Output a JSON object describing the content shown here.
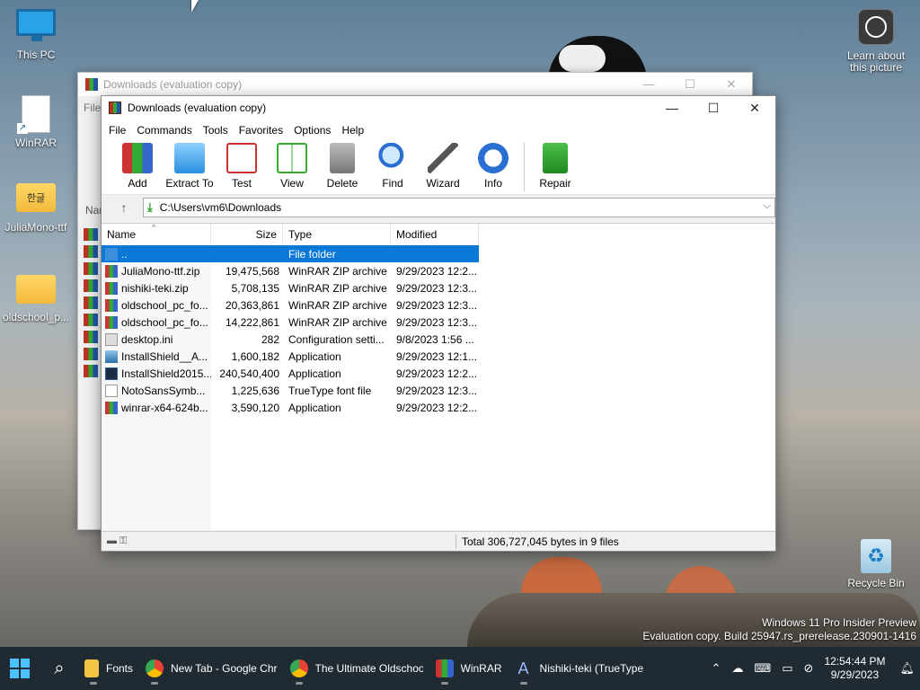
{
  "desktop": {
    "icons": [
      {
        "label": "This PC"
      },
      {
        "label": "WinRAR"
      },
      {
        "label": "JuliaMono-ttf"
      },
      {
        "label": "oldschool_p..."
      }
    ],
    "folder_glyph": "한글",
    "learn_label": "Learn about this picture",
    "recycle_label": "Recycle Bin",
    "watermark_line1": "Windows 11 Pro Insider Preview",
    "watermark_line2": "Evaluation copy. Build 25947.rs_prerelease.230901-1416"
  },
  "back_window": {
    "title": "Downloads (evaluation copy)",
    "menu_peek": "File",
    "col_peek": "Nar"
  },
  "window": {
    "title": "Downloads (evaluation copy)",
    "menu": [
      "File",
      "Commands",
      "Tools",
      "Favorites",
      "Options",
      "Help"
    ],
    "toolbar": [
      {
        "label": "Add",
        "icon": "add-archive-icon"
      },
      {
        "label": "Extract To",
        "icon": "extract-folder-icon"
      },
      {
        "label": "Test",
        "icon": "test-checklist-icon"
      },
      {
        "label": "View",
        "icon": "view-book-icon"
      },
      {
        "label": "Delete",
        "icon": "trash-can-icon"
      },
      {
        "label": "Find",
        "icon": "magnifier-icon"
      },
      {
        "label": "Wizard",
        "icon": "magic-wand-icon"
      },
      {
        "label": "Info",
        "icon": "info-icon"
      },
      {
        "label": "Repair",
        "icon": "repair-kit-icon"
      }
    ],
    "address": "C:\\Users\\vm6\\Downloads",
    "columns": {
      "name": "Name",
      "size": "Size",
      "type": "Type",
      "modified": "Modified"
    },
    "files": [
      {
        "name": "..",
        "size": "",
        "type": "File folder",
        "modified": "",
        "icon": "folder"
      },
      {
        "name": "JuliaMono-ttf.zip",
        "size": "19,475,568",
        "type": "WinRAR ZIP archive",
        "modified": "9/29/2023 12:2...",
        "icon": "zip"
      },
      {
        "name": "nishiki-teki.zip",
        "size": "5,708,135",
        "type": "WinRAR ZIP archive",
        "modified": "9/29/2023 12:3...",
        "icon": "zip"
      },
      {
        "name": "oldschool_pc_fo...",
        "size": "20,363,861",
        "type": "WinRAR ZIP archive",
        "modified": "9/29/2023 12:3...",
        "icon": "zip"
      },
      {
        "name": "oldschool_pc_fo...",
        "size": "14,222,861",
        "type": "WinRAR ZIP archive",
        "modified": "9/29/2023 12:3...",
        "icon": "zip"
      },
      {
        "name": "desktop.ini",
        "size": "282",
        "type": "Configuration setti...",
        "modified": "9/8/2023 1:56 ...",
        "icon": "ini"
      },
      {
        "name": "InstallShield__A...",
        "size": "1,600,182",
        "type": "Application",
        "modified": "9/29/2023 12:1...",
        "icon": "app"
      },
      {
        "name": "InstallShield2015...",
        "size": "240,540,400",
        "type": "Application",
        "modified": "9/29/2023 12:2...",
        "icon": "app2"
      },
      {
        "name": "NotoSansSymb...",
        "size": "1,225,636",
        "type": "TrueType font file",
        "modified": "9/29/2023 12:3...",
        "icon": "font"
      },
      {
        "name": "winrar-x64-624b...",
        "size": "3,590,120",
        "type": "Application",
        "modified": "9/29/2023 12:2...",
        "icon": "zip"
      }
    ],
    "status_total": "Total 306,727,045 bytes in 9 files"
  },
  "taskbar": {
    "apps": [
      {
        "label": "Fonts",
        "icon": "folder-icon"
      },
      {
        "label": "New Tab - Google Chr",
        "icon": "chrome-icon"
      },
      {
        "label": "The Ultimate Oldschoo",
        "icon": "chrome-icon"
      },
      {
        "label": "WinRAR",
        "icon": "winrar-icon"
      },
      {
        "label": "Nishiki-teki (TrueType",
        "icon": "font-icon"
      }
    ],
    "time": "12:54:44 PM",
    "date": "9/29/2023"
  }
}
